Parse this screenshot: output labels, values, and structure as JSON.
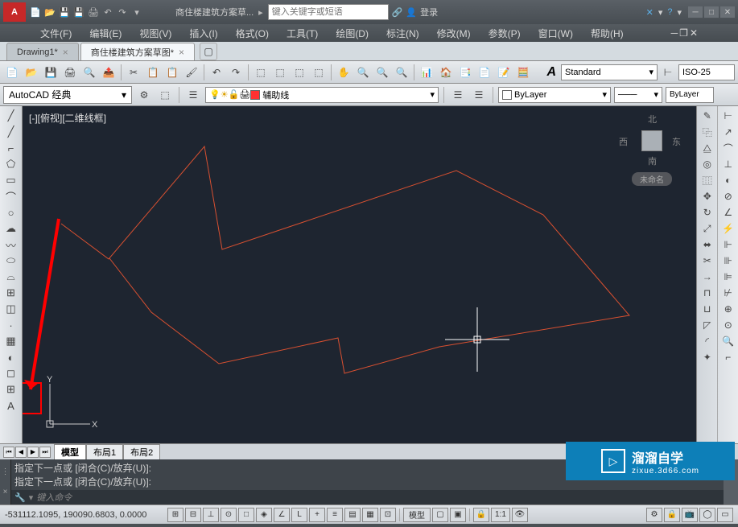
{
  "app": {
    "title": "商住楼建筑方案草...",
    "search_placeholder": "键入关键字或短语",
    "login": "登录"
  },
  "menus": [
    "文件(F)",
    "编辑(E)",
    "视图(V)",
    "插入(I)",
    "格式(O)",
    "工具(T)",
    "绘图(D)",
    "标注(N)",
    "修改(M)",
    "参数(P)",
    "窗口(W)",
    "帮助(H)"
  ],
  "tabs": [
    {
      "label": "Drawing1*",
      "active": false
    },
    {
      "label": "商住楼建筑方案草图*",
      "active": true
    }
  ],
  "workspace": {
    "combo": "AutoCAD 经典",
    "layer": "辅助线",
    "textstyle_label": "Standard",
    "dimstyle_label": "ISO-25",
    "bylayer": "ByLayer",
    "bylayer2": "ByLayer"
  },
  "viewport": {
    "label": "[-][俯视][二维线框]",
    "cube_unnamed": "未命名",
    "dir_n": "北",
    "dir_s": "南",
    "dir_e": "东",
    "dir_w": "西"
  },
  "layout_tabs": [
    "模型",
    "布局1",
    "布局2"
  ],
  "command": {
    "line1": "指定下一点或 [闭合(C)/放弃(U)]:",
    "line2": "指定下一点或 [闭合(C)/放弃(U)]:",
    "prompt": "键入命令"
  },
  "status": {
    "coords": "-531112.1095, 190090.6803, 0.0000",
    "model_space": "模型",
    "annotation": "1:1"
  },
  "watermark": {
    "cn": "溜溜自学",
    "en": "zixue.3d66.com"
  },
  "ucs": {
    "x": "X",
    "y": "Y"
  }
}
